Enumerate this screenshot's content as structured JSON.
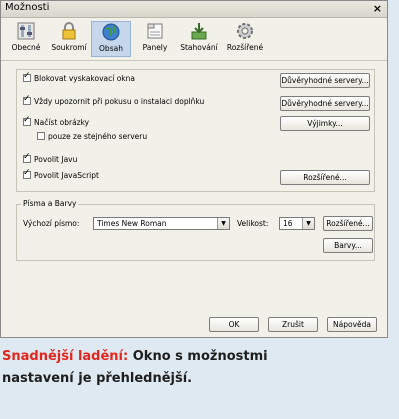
{
  "window": {
    "title": "Možnosti",
    "close": "×"
  },
  "toolbar": [
    {
      "label": "Obecné",
      "icon": "general-switches-icon"
    },
    {
      "label": "Soukromí",
      "icon": "privacy-lock-icon"
    },
    {
      "label": "Obsah",
      "icon": "content-globe-icon",
      "active": true
    },
    {
      "label": "Panely",
      "icon": "tabs-icon"
    },
    {
      "label": "Stahování",
      "icon": "downloads-icon"
    },
    {
      "label": "Rozšířené",
      "icon": "advanced-gear-icon"
    }
  ],
  "content": {
    "block_popups": "Blokovat vyskakovací okna",
    "warn_addons": "Vždy upozornit při pokusu o instalaci doplňku",
    "load_images": "Načíst obrázky",
    "same_server": "pouze ze stejného serveru",
    "enable_java": "Povolit Javu",
    "enable_js": "Povolit JavaScript",
    "btn_trusted1": "Důvěryhodné servery...",
    "btn_trusted2": "Důvěryhodné servery...",
    "btn_exceptions": "Výjimky...",
    "btn_advanced": "Rozšířené..."
  },
  "fonts": {
    "legend": "Písma a Barvy",
    "default_font_label": "Výchozí písmo:",
    "default_font_value": "Times New Roman",
    "size_label": "Velikost:",
    "size_value": "16",
    "btn_advanced": "Rozšířené...",
    "btn_colors": "Barvy..."
  },
  "footer": {
    "ok": "OK",
    "cancel": "Zrušit",
    "help": "Nápověda"
  },
  "caption": {
    "highlight": "Snadnější ladění:",
    "text_line1": " Okno s možnostmi",
    "text_line2": "nastavení je přehlednější."
  },
  "colors": {
    "accent_red": "#e2261d",
    "caption_bg": "#dfe9f2",
    "active_tab": "#c6d7ec"
  }
}
